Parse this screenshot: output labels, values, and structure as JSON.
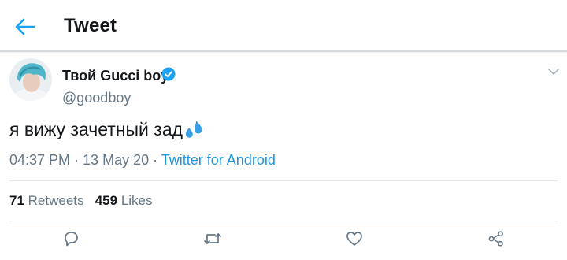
{
  "header": {
    "title": "Tweet",
    "back_icon": "arrow-left-icon",
    "accent_color": "#1da1f2"
  },
  "tweet": {
    "author_name": "Твой Gucci boy",
    "handle": "@goodboy",
    "verified": true,
    "text": "я вижу зачетный зад",
    "emoji": "sweat-droplets-emoji",
    "time": "04:37 PM",
    "separator": " · ",
    "date": "13 May 20",
    "source": "Twitter for Android",
    "retweets_count": "71",
    "retweets_label": "Retweets",
    "likes_count": "459",
    "likes_label": "Likes"
  },
  "actions": [
    "reply-icon",
    "retweet-icon",
    "like-icon",
    "share-icon"
  ],
  "colors": {
    "text": "#14171a",
    "secondary": "#657786",
    "link": "#1b95e0",
    "divider": "#e1e8ed"
  }
}
